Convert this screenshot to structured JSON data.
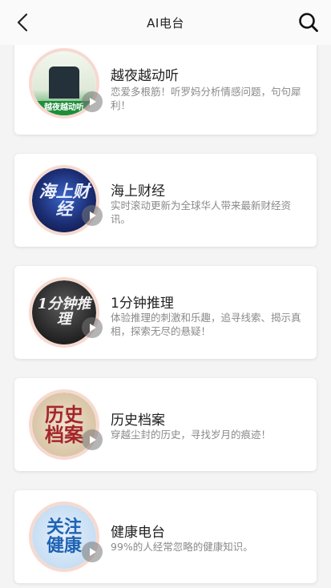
{
  "header": {
    "title": "AI电台",
    "back_icon": "chevron-left-icon",
    "search_icon": "search-icon"
  },
  "colors": {
    "card_bg": "#ffffff",
    "page_bg": "#f4f4f4",
    "thumb_ring": "#f6d9d0",
    "desc_text": "#8a8a8a"
  },
  "items": [
    {
      "title": "越夜越动听",
      "desc": "恋爱多根筋！听罗妈分析情感问题，句句犀利！",
      "thumb_text": "越夜越动听",
      "thumb_top_text": "越夜越动听"
    },
    {
      "title": "海上财经",
      "desc": "实时滚动更新为全球华人带来最新财经资讯。",
      "thumb_text": "海上财经"
    },
    {
      "title": "1分钟推理",
      "desc": "体验推理的刺激和乐趣，追寻线索、揭示真相，探索无尽的悬疑！",
      "thumb_text": "1分钟推理"
    },
    {
      "title": "历史档案",
      "desc": "穿越尘封的历史，寻找岁月的痕迹！",
      "thumb_text": "历史档案"
    },
    {
      "title": "健康电台",
      "desc": "99%的人经常忽略的健康知识。",
      "thumb_text": "关注健康"
    }
  ]
}
